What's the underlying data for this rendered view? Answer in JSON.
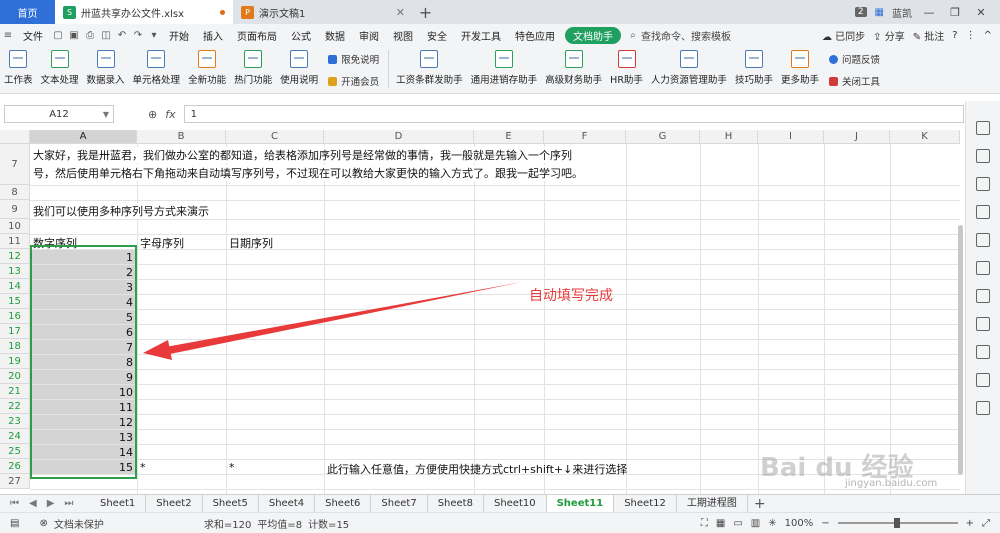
{
  "tabs": {
    "home": "首页",
    "active_doc": "卅蓝共享办公文件.xlsx",
    "other_doc": "演示文稿1",
    "new_tab": "+",
    "right_badge": "2",
    "user": "蓝凯"
  },
  "menu": {
    "file": "文件",
    "items": [
      "开始",
      "插入",
      "页面布局",
      "公式",
      "数据",
      "审阅",
      "视图",
      "安全",
      "开发工具",
      "特色应用"
    ],
    "helper": "文档助手",
    "search": "查找命令、搜索模板",
    "sync": "已同步",
    "share": "分享",
    "comment": "批注"
  },
  "ribbon": {
    "groups": [
      "工作表",
      "文本处理",
      "数据录入",
      "单元格处理",
      "全新功能",
      "热门功能",
      "使用说明"
    ],
    "stack1": [
      "限免说明",
      "开通会员"
    ],
    "helpers": [
      "工资条群发助手",
      "通用进销存助手",
      "高级财务助手",
      "HR助手",
      "人力资源管理助手",
      "技巧助手",
      "更多助手"
    ],
    "stack2": [
      "问题反馈",
      "关闭工具"
    ]
  },
  "formula": {
    "cell_ref": "A12",
    "fx": "fx",
    "value": "1"
  },
  "grid": {
    "columns": [
      "A",
      "B",
      "C",
      "D",
      "E",
      "F",
      "G",
      "H",
      "I",
      "J",
      "K"
    ],
    "rows": [
      "7",
      "8",
      "9",
      "10",
      "11",
      "12",
      "13",
      "14",
      "15",
      "16",
      "17",
      "18",
      "19",
      "20",
      "21",
      "22",
      "23",
      "24",
      "25",
      "26",
      "27"
    ],
    "row7_line1": "大家好，我是卅蓝君，我们做办公室的都知道，给表格添加序列号是经常做的事情，我一般就是先输入一个序列",
    "row7_line2": "号，然后使用单元格右下角拖动来自动填写序列号，不过现在可以教给大家更快的输入方式了。跟我一起学习吧。",
    "row9": "我们可以使用多种序列号方式来演示",
    "h_num": "数字序列",
    "h_letter": "字母序列",
    "h_date": "日期序列",
    "numbers": [
      "1",
      "2",
      "3",
      "4",
      "5",
      "6",
      "7",
      "8",
      "9",
      "10",
      "11",
      "12",
      "13",
      "14",
      "15"
    ],
    "b26": "*",
    "c26": "*",
    "d26": "此行输入任意值，方便使用快捷方式ctrl+shift+↓来进行选择",
    "annotation": "自动填写完成"
  },
  "sheets": {
    "names": [
      "Sheet1",
      "Sheet2",
      "Sheet5",
      "Sheet4",
      "Sheet6",
      "Sheet7",
      "Sheet8",
      "Sheet10",
      "Sheet11",
      "Sheet12",
      "工期进程图"
    ],
    "active_index": 8
  },
  "status": {
    "protect": "文档未保护",
    "sum": "求和=120",
    "avg": "平均值=8",
    "count": "计数=15",
    "zoom": "100%"
  },
  "watermark": {
    "text": "Bai du 经验",
    "url": "jingyan.baidu.com"
  },
  "colors": {
    "accent_blue": "#2e6fd8",
    "helper_green": "#1fa060",
    "selection_green": "#2e9e4a",
    "annotation_red": "#e83a3a"
  }
}
